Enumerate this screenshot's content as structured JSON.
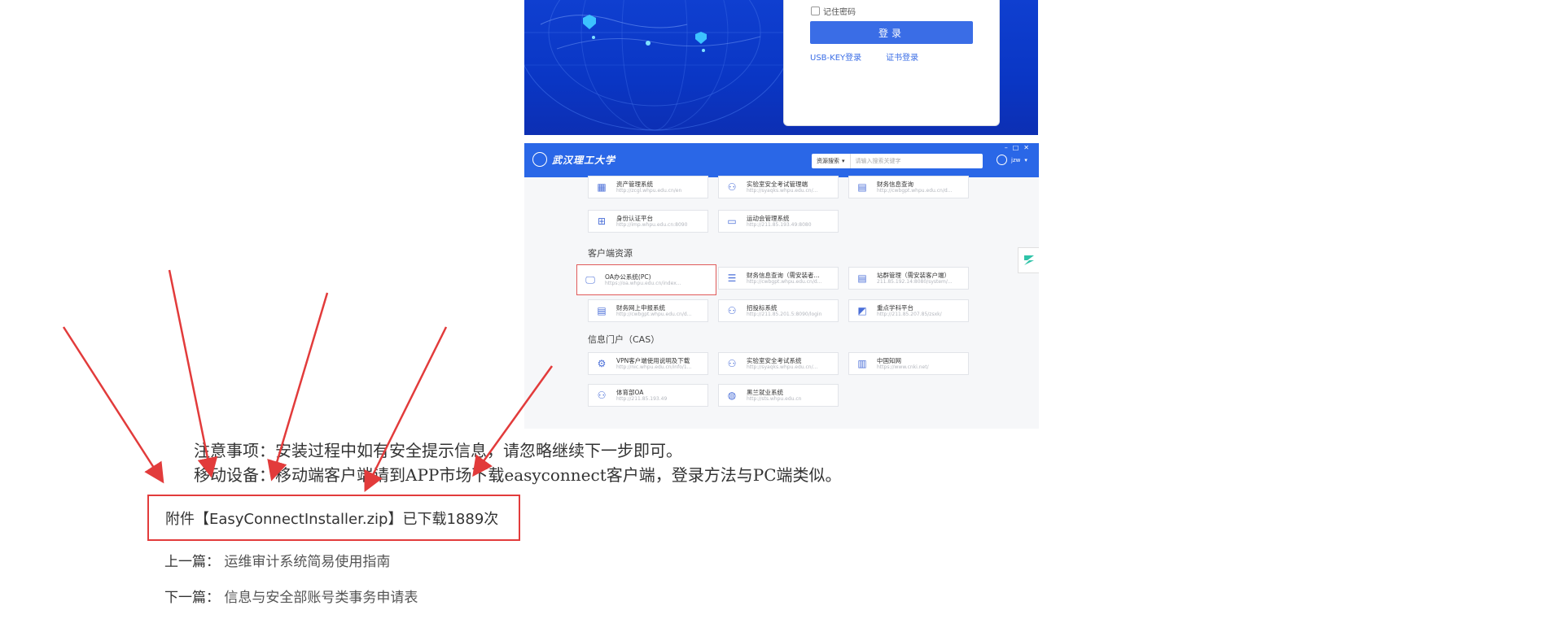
{
  "login_screen": {
    "remember_label": "记住密码",
    "login_button": "登录",
    "links": [
      "USB-KEY登录",
      "证书登录"
    ]
  },
  "portal": {
    "logo_text": "武汉理工大学",
    "search_type": "资源搜索",
    "search_placeholder": "请输入搜索关键字",
    "user_name": "jzw",
    "top_tiles": [
      {
        "name": "资产管理系统",
        "url": "http://zcgl.whpu.edu.cn/en"
      },
      {
        "name": "实验室安全考试管理端",
        "url": "http://syaqks.whpu.edu.cn/..."
      },
      {
        "name": "财务信息查询",
        "url": "http://cwbgpt.whpu.edu.cn/d..."
      },
      {
        "name": "身份认证平台",
        "url": "http://imp.whpu.edu.cn:8090"
      },
      {
        "name": "运动会管理系统",
        "url": "http://211.85.193.49:8080"
      }
    ],
    "client_section_title": "客户端资源",
    "client_tiles": [
      {
        "name": "OA办公系统(PC)",
        "url": "https://oa.whpu.edu.cn/index..."
      },
      {
        "name": "财务信息查询（需安装者...",
        "url": "http://cwbgpt.whpu.edu.cn/d..."
      },
      {
        "name": "站群管理（需安装客户端）",
        "url": "211.85.192.14:8080/system/..."
      },
      {
        "name": "财务网上申报系统",
        "url": "http://cwbgpt.whpu.edu.cn/d..."
      },
      {
        "name": "招投标系统",
        "url": "http://211.85.201.5:8090/login"
      },
      {
        "name": "重点学科平台",
        "url": "http://211.85.207.85/zsxk/"
      }
    ],
    "cas_section_title": "信息门户（CAS）",
    "cas_tiles": [
      {
        "name": "VPN客户端使用说明及下载",
        "url": "http://nic.whpu.edu.cn/info/1..."
      },
      {
        "name": "实验室安全考试系统",
        "url": "http://syaqks.whpu.edu.cn/..."
      },
      {
        "name": "中国知网",
        "url": "https://www.cnki.net/"
      },
      {
        "name": "体育部OA",
        "url": "http://211.85.193.49"
      },
      {
        "name": "黑兰就业系统",
        "url": "http://sts.whpu.edu.cn"
      }
    ]
  },
  "notes": {
    "line1": "注意事项：安装过程中如有安全提示信息，请忽略继续下一步即可。",
    "line2": "移动设备：移动端客户端请到APP市场下载easyconnect客户端，登录方法与PC端类似。"
  },
  "attachment": {
    "text": "附件【EasyConnectInstaller.zip】已下载1889次"
  },
  "navigation": {
    "prev_label": "上一篇：",
    "prev_title": "运维审计系统简易使用指南",
    "next_label": "下一篇：",
    "next_title": "信息与安全部账号类事务申请表"
  },
  "colors": {
    "login_bg": "#0f3fd0",
    "portal_header": "#2a67e7",
    "button_blue": "#3a6de6",
    "highlight_red": "#e23b3b"
  }
}
